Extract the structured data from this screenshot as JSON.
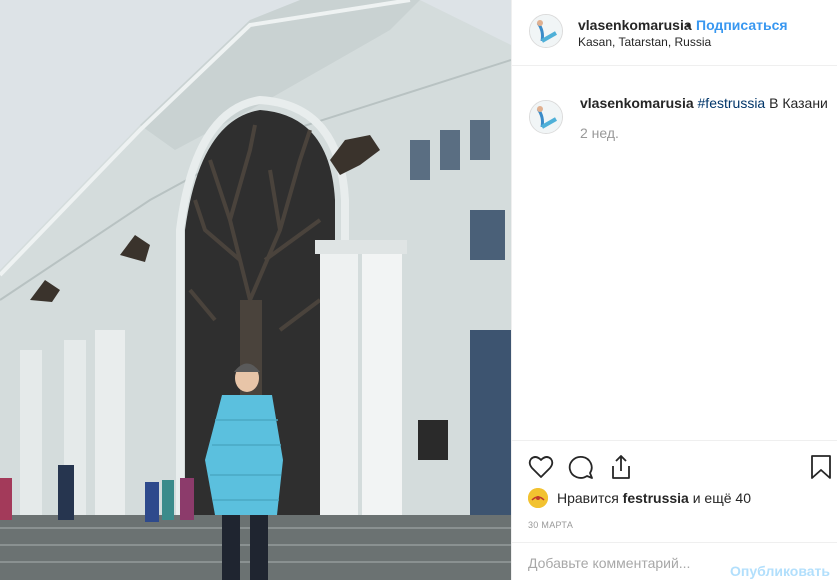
{
  "post": {
    "username": "vlasenkomarusia",
    "separator": "•",
    "follow_label": "Подписаться",
    "location": "Kasan, Tatarstan, Russia",
    "caption": {
      "username": "vlasenkomarusia",
      "hashtag": "#festrussia",
      "text": " В Казани",
      "time_ago": "2 нед."
    },
    "actions": {
      "like_icon": "heart-icon",
      "comment_icon": "comment-icon",
      "share_icon": "share-icon",
      "save_icon": "bookmark-icon"
    },
    "likes": {
      "prefix": "Нравится ",
      "user": "festrussia",
      "suffix": " и ещё 40",
      "avatar_color": "#f2c230"
    },
    "date": "30 МАРТА",
    "add_comment_placeholder": "Добавьте комментарий...",
    "publish_label": "Опубликовать"
  },
  "colors": {
    "link_blue": "#3897f0",
    "hashtag": "#003569",
    "publish_disabled": "#b2dffc",
    "muted": "#999999",
    "sky": "#dfe5e9",
    "coat": "#5bc0de"
  }
}
